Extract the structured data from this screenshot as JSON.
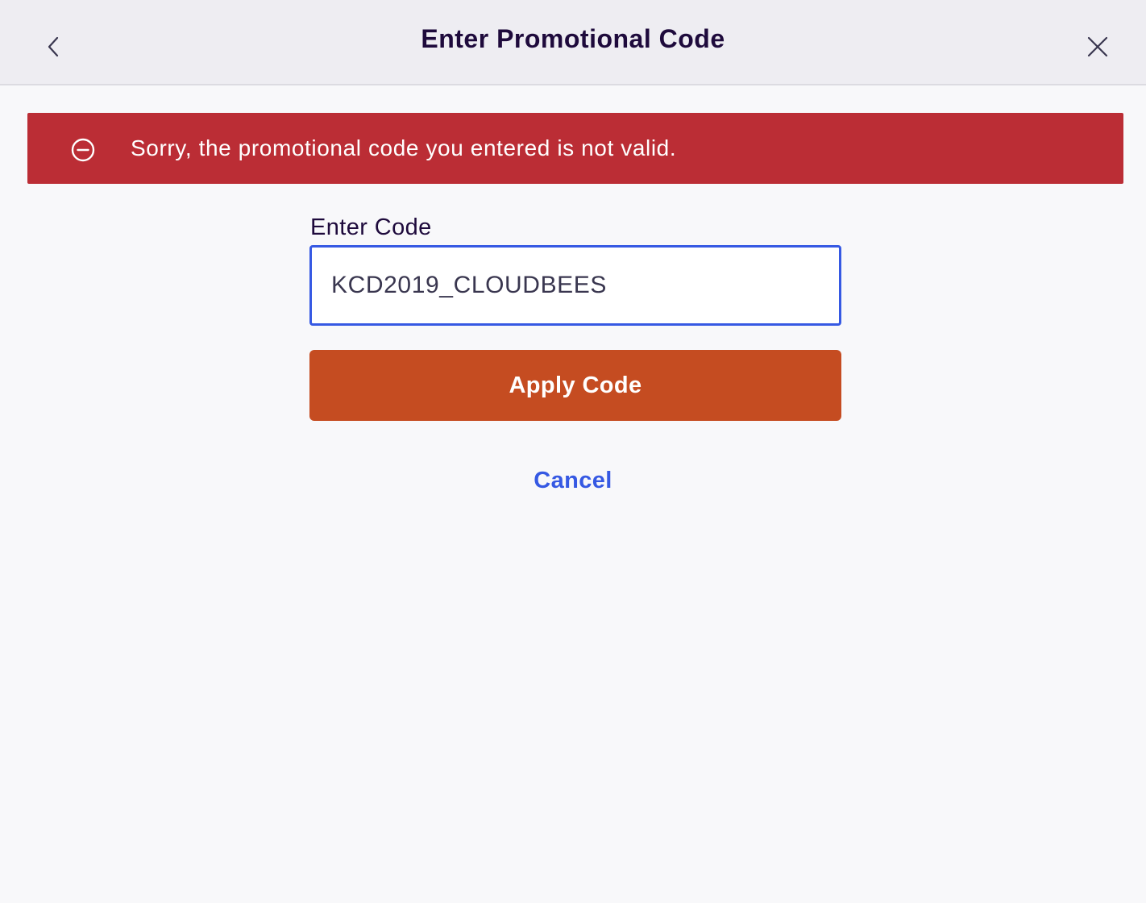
{
  "header": {
    "title": "Enter Promotional Code",
    "back_icon": "chevron-left-icon",
    "close_icon": "close-icon"
  },
  "error": {
    "message": "Sorry, the promotional code you entered is not valid.",
    "icon": "minus-circle-icon",
    "color": "#bb2d35"
  },
  "form": {
    "label": "Enter Code",
    "code_value": "KCD2019_CLOUDBEES",
    "apply_label": "Apply Code",
    "cancel_label": "Cancel"
  },
  "colors": {
    "accent": "#3659e3",
    "primary_button": "#c54c21",
    "title_text": "#1e0a3c"
  }
}
